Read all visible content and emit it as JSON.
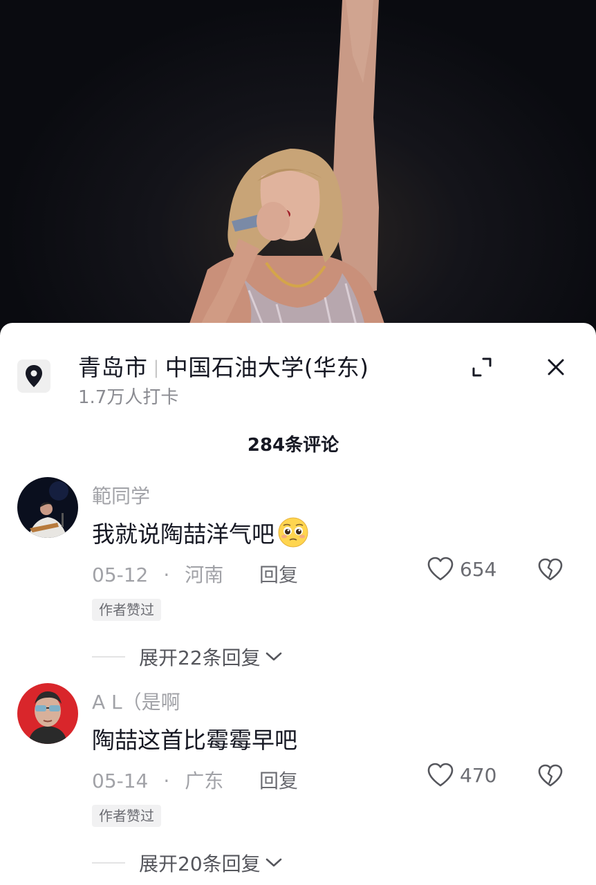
{
  "location": {
    "city": "青岛市",
    "place": "中国石油大学(华东)",
    "checkins": "1.7万人打卡"
  },
  "comment_count": "284条评论",
  "comments": [
    {
      "username": "範同学",
      "text": "我就说陶喆洋气吧",
      "emoji": "pleading-face-emoji",
      "date": "05-12",
      "dot": "·",
      "region": "河南",
      "reply_label": "回复",
      "likes": "654",
      "badge": "作者赞过",
      "expand_label": "展开22条回复"
    },
    {
      "username": "A L（是啊",
      "text": "陶喆这首比霉霉早吧",
      "date": "05-14",
      "dot": "·",
      "region": "广东",
      "reply_label": "回复",
      "likes": "470",
      "badge": "作者赞过",
      "expand_label": "展开20条回复"
    }
  ],
  "colors": {
    "primary_text": "#161823",
    "secondary_text": "#a1a2a7",
    "sheet_bg": "#ffffff",
    "video_bg": "#0b0c0f"
  }
}
